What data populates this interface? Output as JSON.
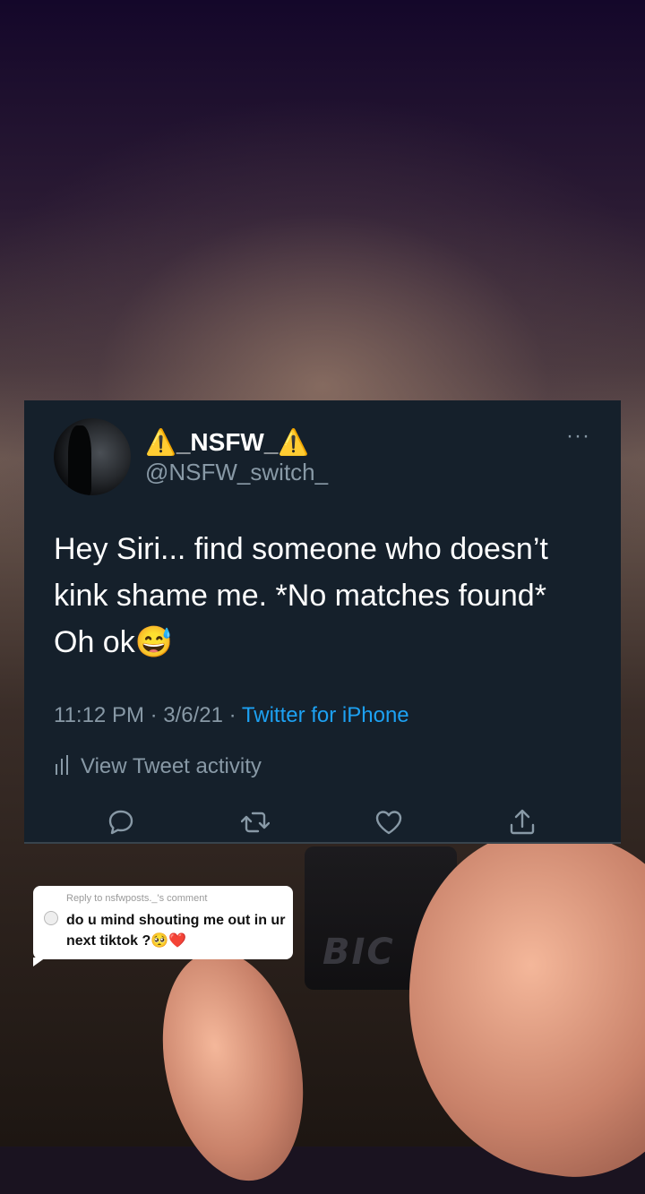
{
  "tweet": {
    "display_name": "⚠️_NSFW_⚠️",
    "handle": "@NSFW_switch_",
    "more_icon": "···",
    "text": "Hey Siri... find someone who doesn’t kink shame me. *No matches found* Oh ok😅",
    "timestamp": "11:12 PM · 3/6/21 · ",
    "source": "Twitter for iPhone",
    "activity_label": "View Tweet activity",
    "actions": [
      "reply-icon",
      "retweet-icon",
      "like-icon",
      "share-icon"
    ]
  },
  "reply_bubble": {
    "header": "Reply to nsfwposts._'s comment",
    "text": "do u mind shouting me out in ur next tiktok ?🥺❤️"
  },
  "background": {
    "lighter_brand": "BIC"
  },
  "colors": {
    "tweet_bg": "#15202b",
    "link": "#1da1f2",
    "secondary_text": "#8899a6"
  }
}
